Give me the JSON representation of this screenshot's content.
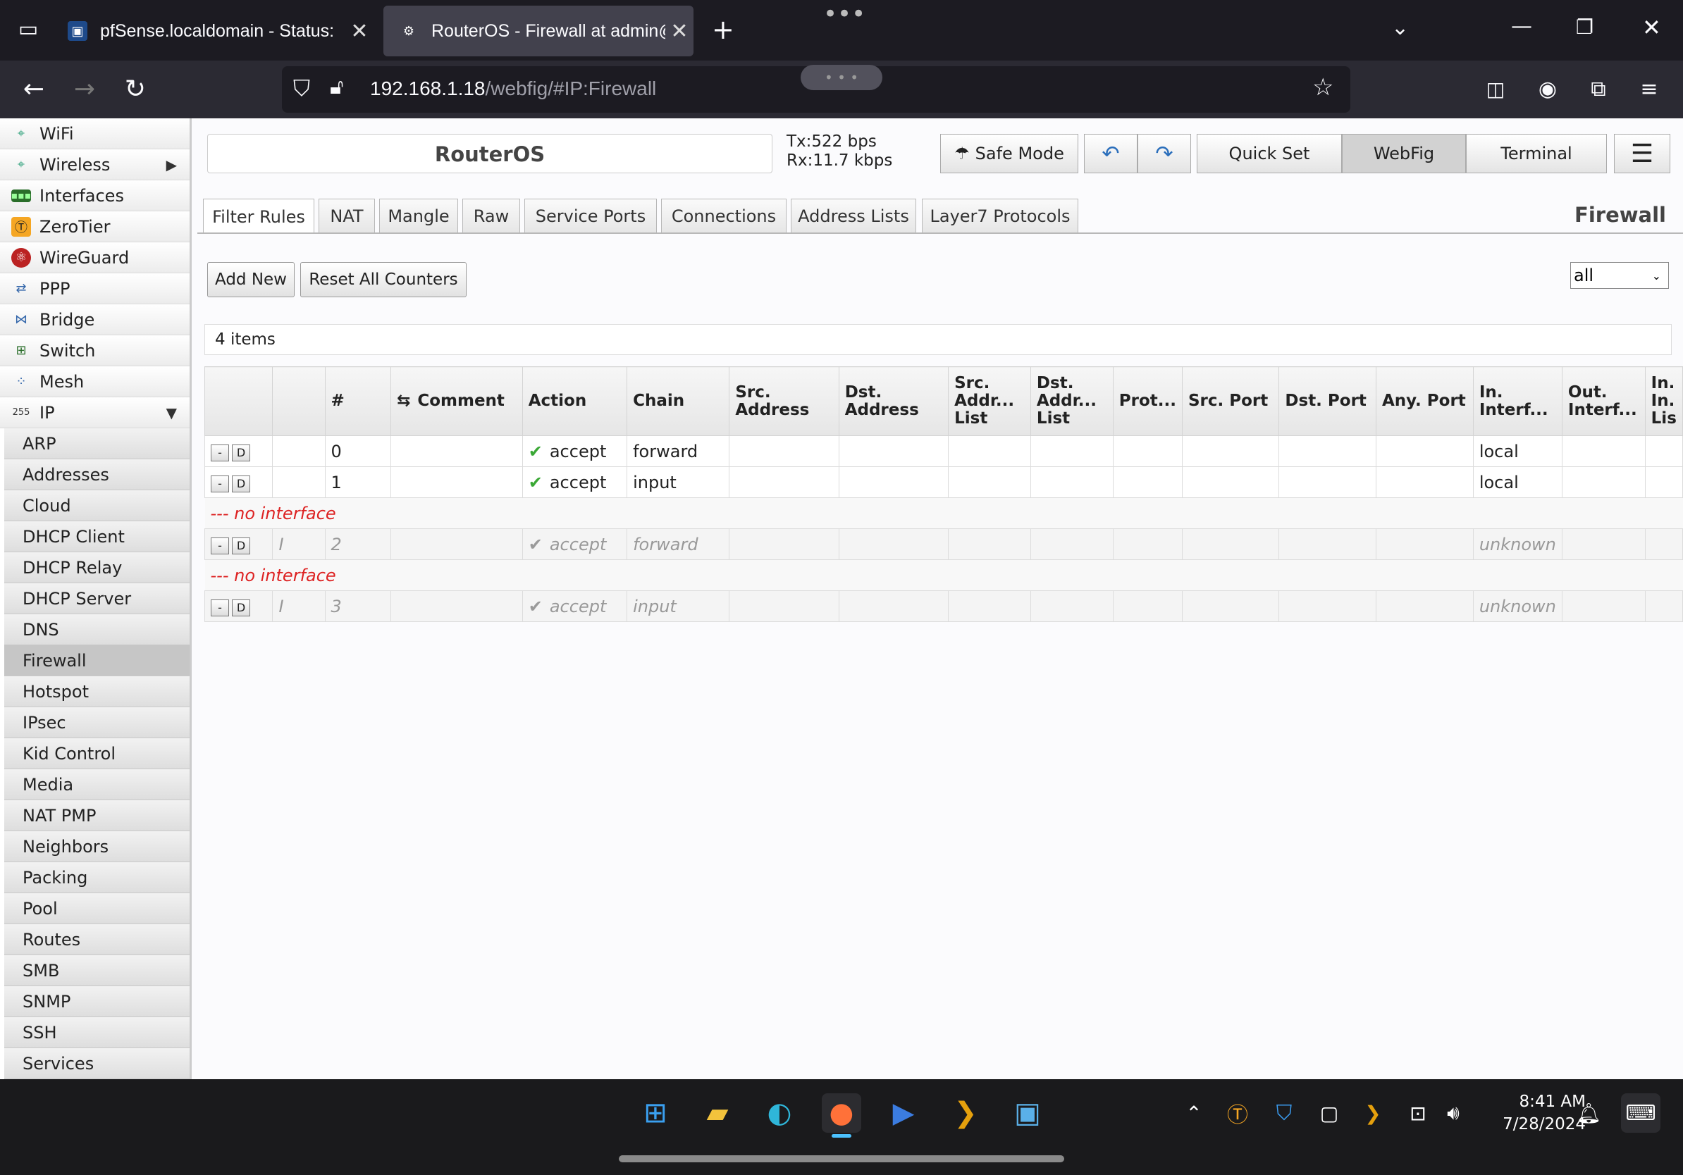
{
  "browser": {
    "tabs": [
      {
        "title": "pfSense.localdomain - Status:",
        "active": false
      },
      {
        "title": "RouterOS - Firewall at admin@",
        "active": true
      }
    ],
    "url_host": "192.168.1.18",
    "url_path": "/webfig/#IP:Firewall"
  },
  "sidebar": {
    "items": [
      {
        "label": "WiFi",
        "icon": "wifi-icon"
      },
      {
        "label": "Wireless",
        "icon": "wireless-icon",
        "arrow": "▶"
      },
      {
        "label": "Interfaces",
        "icon": "interfaces-icon"
      },
      {
        "label": "ZeroTier",
        "icon": "zerotier-icon"
      },
      {
        "label": "WireGuard",
        "icon": "wireguard-icon"
      },
      {
        "label": "PPP",
        "icon": "ppp-icon"
      },
      {
        "label": "Bridge",
        "icon": "bridge-icon"
      },
      {
        "label": "Switch",
        "icon": "switch-icon"
      },
      {
        "label": "Mesh",
        "icon": "mesh-icon"
      },
      {
        "label": "IP",
        "icon": "ip-icon",
        "arrow": "▼"
      }
    ],
    "subitems": [
      "ARP",
      "Addresses",
      "Cloud",
      "DHCP Client",
      "DHCP Relay",
      "DHCP Server",
      "DNS",
      "Firewall",
      "Hotspot",
      "IPsec",
      "Kid Control",
      "Media",
      "NAT PMP",
      "Neighbors",
      "Packing",
      "Pool",
      "Routes",
      "SMB",
      "SNMP",
      "SSH",
      "Services"
    ],
    "active_sub": "Firewall"
  },
  "header": {
    "title": "RouterOS",
    "tx": "Tx:522 bps",
    "rx": "Rx:11.7 kbps",
    "safe_mode": "Safe Mode",
    "quick_set": "Quick Set",
    "webfig": "WebFig",
    "terminal": "Terminal"
  },
  "tabs": [
    "Filter Rules",
    "NAT",
    "Mangle",
    "Raw",
    "Service Ports",
    "Connections",
    "Address Lists",
    "Layer7 Protocols"
  ],
  "section_title": "Firewall",
  "toolbar": {
    "add_new": "Add New",
    "reset_counters": "Reset All Counters",
    "filter_value": "all"
  },
  "item_count": "4 items",
  "table": {
    "columns": [
      "#",
      "Comment",
      "Action",
      "Chain",
      "Src. Address",
      "Dst. Address",
      "Src. Addr... List",
      "Dst. Addr... List",
      "Prot...",
      "Src. Port",
      "Dst. Port",
      "Any. Port",
      "In. Interf...",
      "Out. Interf...",
      "In. In. Lis"
    ],
    "group_label": "--- no interface",
    "rows": [
      {
        "num": "0",
        "action": "accept",
        "chain": "forward",
        "in_iface": "local",
        "disabled": false
      },
      {
        "num": "1",
        "action": "accept",
        "chain": "input",
        "in_iface": "local",
        "disabled": false
      },
      {
        "num": "2",
        "action": "accept",
        "chain": "forward",
        "in_iface": "unknown",
        "disabled": true,
        "flag": "I"
      },
      {
        "num": "3",
        "action": "accept",
        "chain": "input",
        "in_iface": "unknown",
        "disabled": true,
        "flag": "I"
      }
    ],
    "btn_remove": "-",
    "btn_disable": "D"
  },
  "taskbar": {
    "time": "8:41 AM",
    "date": "7/28/2024"
  },
  "colors": {
    "accent_green": "#3aa835",
    "group_red": "#d22222"
  }
}
